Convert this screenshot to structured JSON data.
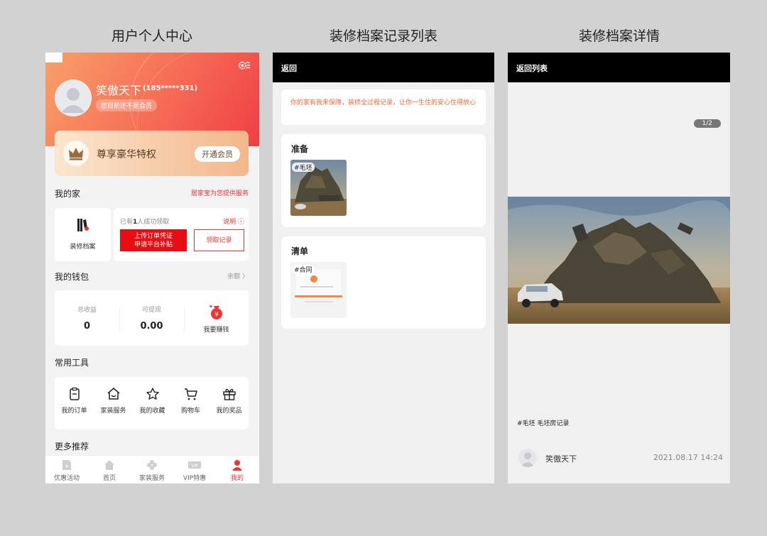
{
  "captions": {
    "profile": "用户个人中心",
    "list": "装修档案记录列表",
    "detail": "装修档案详情"
  },
  "profile": {
    "user": {
      "name": "笑傲天下",
      "phone": "(185*****331)",
      "member_status": "您目前还不是会员"
    },
    "vip": {
      "title": "尊享豪华特权",
      "button": "开通会员"
    },
    "my_home": {
      "title": "我的家",
      "link": "居家宝为您提供服务",
      "archive_label": "装修档案",
      "claim_prefix": "已有",
      "claim_count": "1",
      "claim_suffix": "人成功领取",
      "help": "说明 ⓘ",
      "upload_line1": "上传订单凭证",
      "upload_line2": "申请平台补贴",
      "record_button": "领取记录"
    },
    "wallet": {
      "title": "我的钱包",
      "link": "余额 〉",
      "total_label": "总收益",
      "total_value": "0",
      "withdraw_label": "可提现",
      "withdraw_value": "0.00",
      "earn_label": "我要赚钱"
    },
    "tools": {
      "title": "常用工具",
      "items": [
        "我的订单",
        "家装服务",
        "我的收藏",
        "购物车",
        "我的奖品"
      ]
    },
    "more_title": "更多推荐",
    "tabbar": {
      "items": [
        "优惠活动",
        "首页",
        "家装服务",
        "VIP特惠",
        "我的"
      ],
      "active_color": "#e33333"
    }
  },
  "list_screen": {
    "back": "返回",
    "notice": "你的家有我来保障，装修全过程记录，让你一生住的安心住得放心",
    "groups": [
      {
        "title": "准备",
        "thumb_tag": "#毛坯"
      },
      {
        "title": "清单",
        "thumb_tag": "#合同"
      }
    ]
  },
  "detail_screen": {
    "back": "返回列表",
    "pager": "1/2",
    "tag_text": "#毛坯 毛坯房记录",
    "user_name": "笑傲天下",
    "time": "2021.08.17 14:24"
  }
}
